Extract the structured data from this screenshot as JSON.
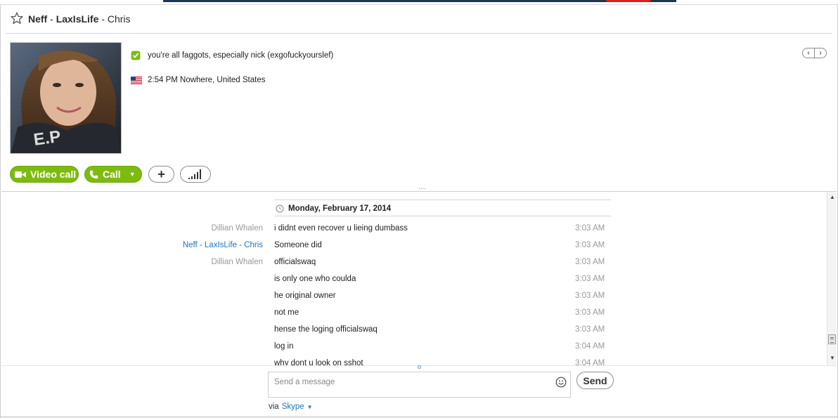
{
  "header": {
    "contact_name": "Neff",
    "contact_sep": " - ",
    "contact_handle": "LaxIsLife",
    "contact_suffix": "  - Chris"
  },
  "profile": {
    "mood": "you're all faggots, especially nick (exgofuckyourslef)",
    "local_time_location": "2:54 PM Nowhere, United States"
  },
  "actions": {
    "video_call_label": "Video call",
    "call_label": "Call"
  },
  "conversation": {
    "date": "Monday, February 17, 2014",
    "messages": [
      {
        "sender": "Dillian Whalen",
        "text": "i didnt even recover u lieing dumbass",
        "time": "3:03 AM"
      },
      {
        "sender": "Neff - LaxIsLife  - Chris",
        "text": "Someone did",
        "time": "3:03 AM"
      },
      {
        "sender": "Dillian Whalen",
        "text": "officialswaq",
        "time": "3:03 AM"
      },
      {
        "sender": "",
        "text": "is only one who coulda",
        "time": "3:03 AM"
      },
      {
        "sender": "",
        "text": "he original owner",
        "time": "3:03 AM"
      },
      {
        "sender": "",
        "text": "not me",
        "time": "3:03 AM"
      },
      {
        "sender": "",
        "text": "hense the loging officialswaq",
        "time": "3:03 AM"
      },
      {
        "sender": "",
        "text": "log in",
        "time": "3:04 AM"
      },
      {
        "sender": "",
        "text": "why dont u look on sshot",
        "time": "3:04 AM"
      }
    ]
  },
  "compose": {
    "placeholder": "Send a message",
    "send_label": "Send",
    "via_prefix": "via",
    "via_service": "Skype"
  },
  "colors": {
    "accent_green": "#7dbb10",
    "link_blue": "#1c75bc"
  }
}
